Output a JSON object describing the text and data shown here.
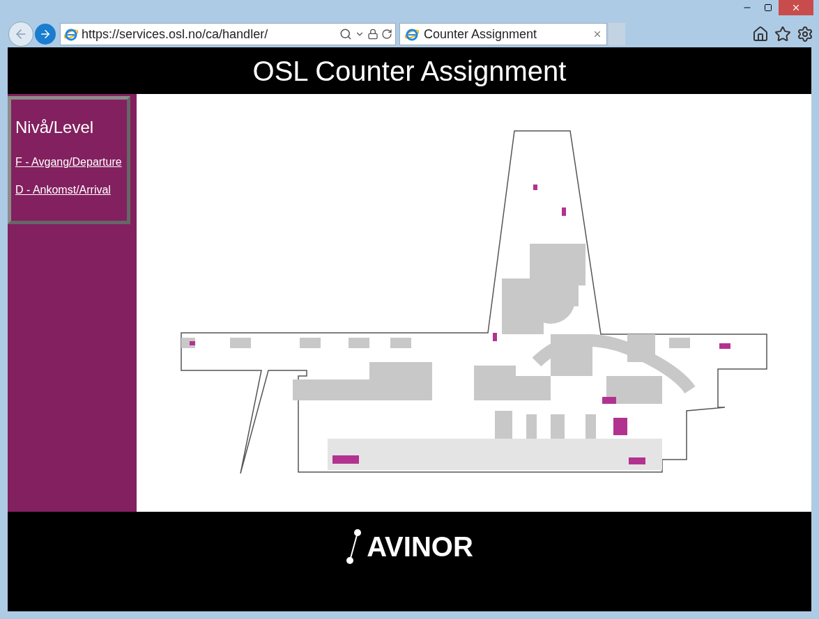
{
  "browser": {
    "address": "https://services.osl.no/ca/handler/",
    "tabs": [
      {
        "label": "Counter Assignment",
        "selected": true
      }
    ]
  },
  "header": {
    "title": "OSL Counter Assignment"
  },
  "sidebar": {
    "heading": "Nivå/Level",
    "links": [
      {
        "label": "F - Avgang/Departure"
      },
      {
        "label": "D - Ankomst/Arrival"
      }
    ]
  },
  "footer": {
    "logo_text": "AVINOR"
  }
}
